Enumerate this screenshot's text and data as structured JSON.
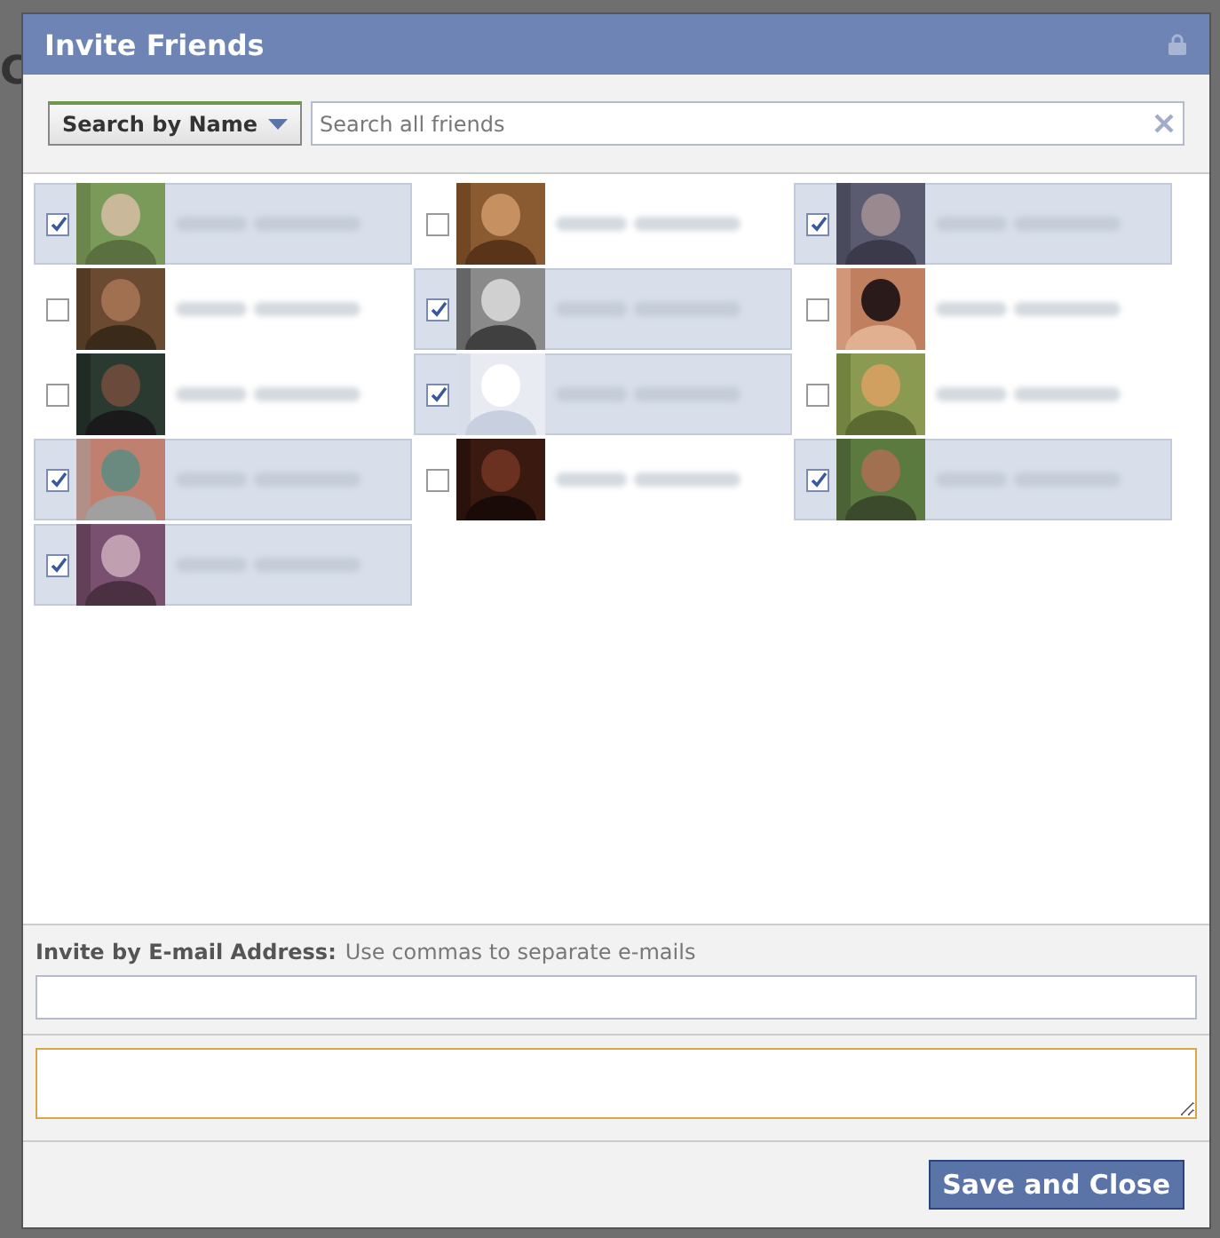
{
  "backdrop": {
    "cut_text": "C"
  },
  "dialog": {
    "title": "Invite Friends",
    "search": {
      "mode_button": "Search by Name",
      "placeholder": "Search all friends"
    },
    "friends": [
      {
        "selected": true
      },
      {
        "selected": false
      },
      {
        "selected": true
      },
      {
        "selected": false
      },
      {
        "selected": true
      },
      {
        "selected": false
      },
      {
        "selected": false
      },
      {
        "selected": true
      },
      {
        "selected": false
      },
      {
        "selected": true
      },
      {
        "selected": false
      },
      {
        "selected": true
      },
      {
        "selected": true
      }
    ],
    "email": {
      "label": "Invite by E-mail Address:",
      "hint": "Use commas to separate e-mails"
    },
    "save_button": "Save and Close"
  }
}
